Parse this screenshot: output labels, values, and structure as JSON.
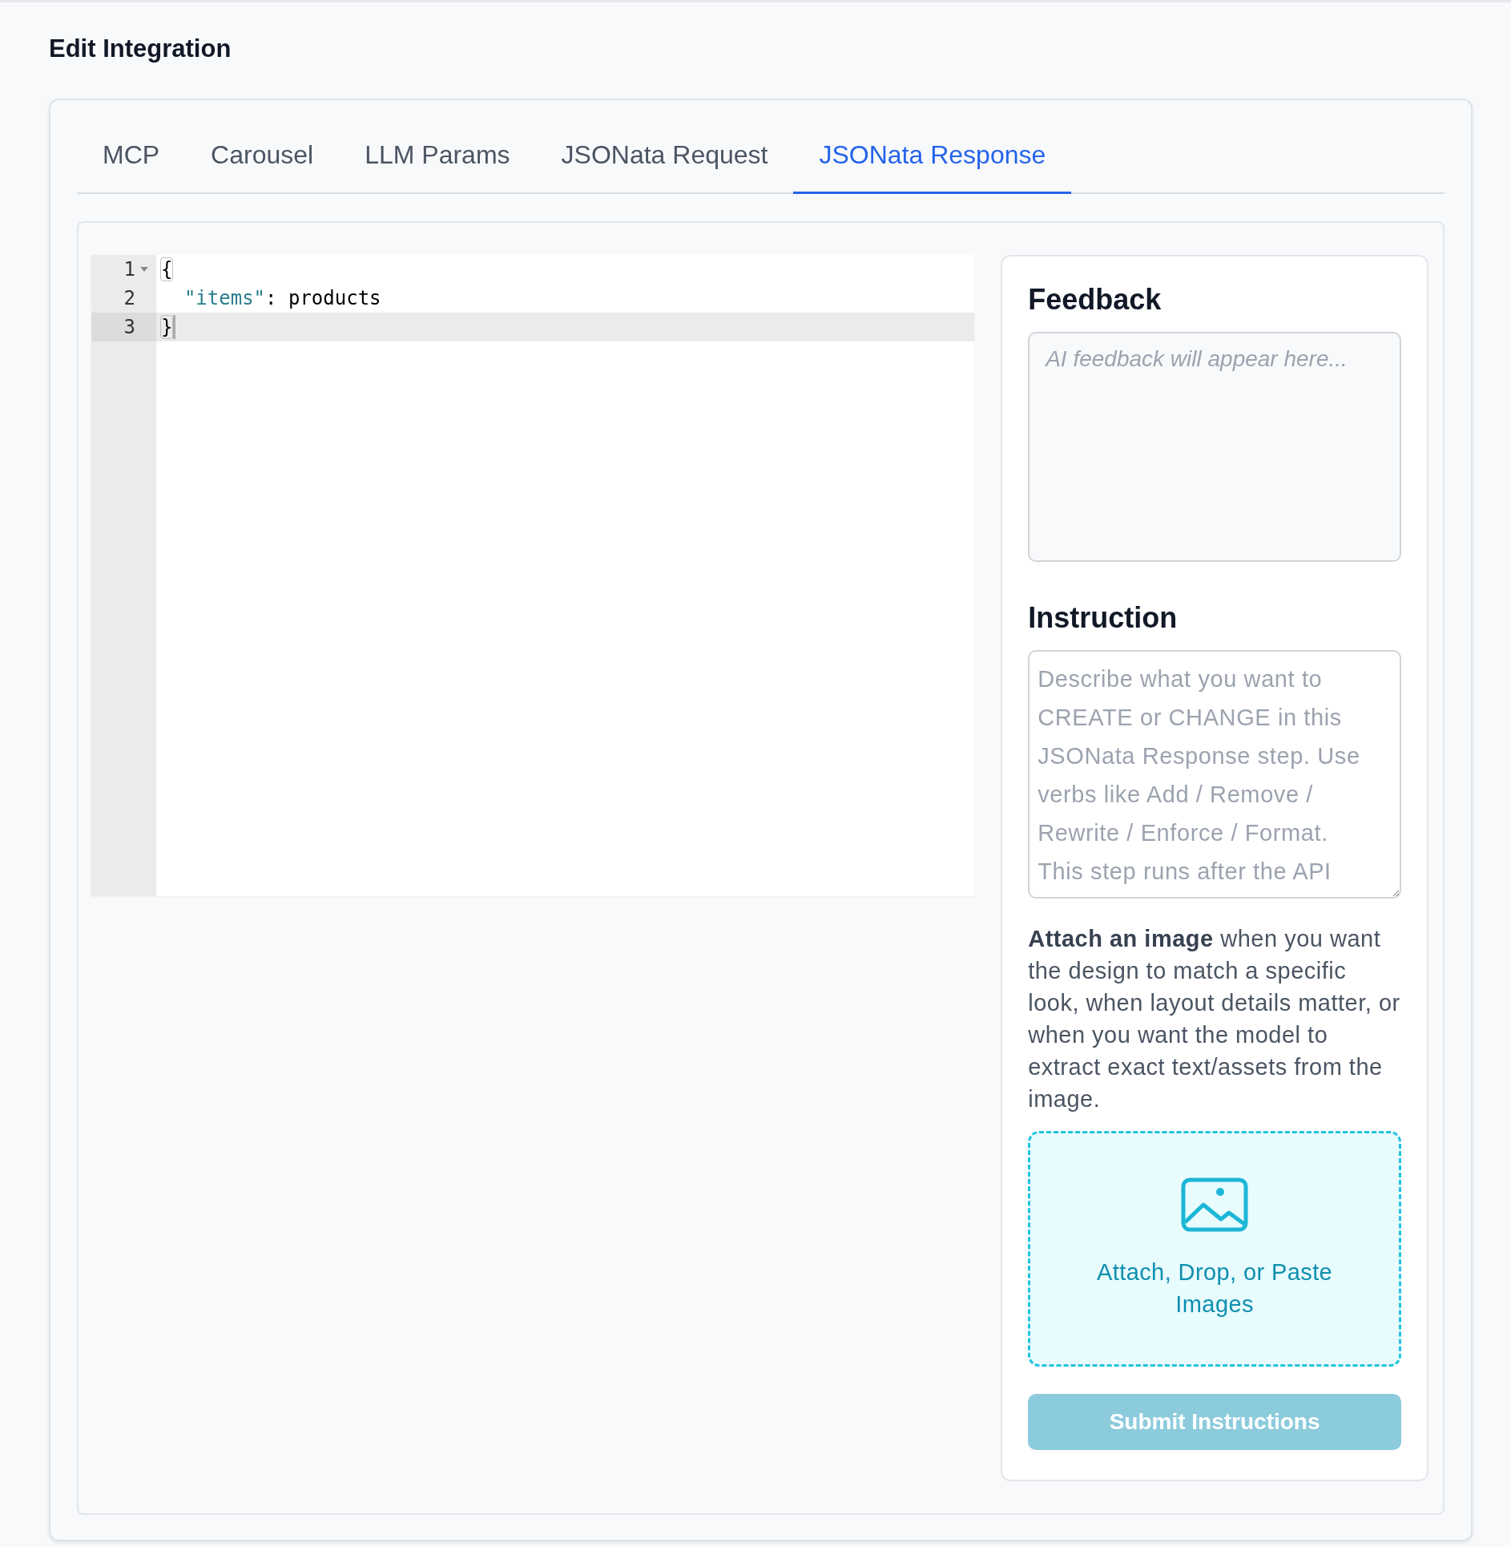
{
  "page_title": "Edit Integration",
  "tabs": [
    {
      "label": "MCP",
      "selected": false
    },
    {
      "label": "Carousel",
      "selected": false
    },
    {
      "label": "LLM Params",
      "selected": false
    },
    {
      "label": "JSONata Request",
      "selected": false
    },
    {
      "label": "JSONata Response",
      "selected": true
    }
  ],
  "editor": {
    "lines": [
      {
        "number": "1",
        "foldable": true,
        "active": false,
        "tokens": [
          {
            "kind": "bracket",
            "text": "{"
          }
        ]
      },
      {
        "number": "2",
        "foldable": false,
        "active": false,
        "tokens": [
          {
            "kind": "string",
            "text": "  \"items\""
          },
          {
            "kind": "plain",
            "text": ": products"
          }
        ]
      },
      {
        "number": "3",
        "foldable": false,
        "active": true,
        "tokens": [
          {
            "kind": "bracket",
            "text": "}"
          }
        ]
      }
    ]
  },
  "feedback": {
    "heading": "Feedback",
    "placeholder": "AI feedback will appear here..."
  },
  "instruction": {
    "heading": "Instruction",
    "placeholder": "Describe what you want to CREATE or CHANGE in this JSONata Response step. Use verbs like Add / Remove / Rewrite / Enforce / Format.\nThis step runs after the API"
  },
  "attach_note": "**Attach an image** when you want the design to match a specific look, when layout details matter, or when you want the model to extract exact text/assets from the image.",
  "dropzone": {
    "label": "Attach, Drop, or Paste Images"
  },
  "submit": {
    "label": "Submit Instructions",
    "disabled": true
  }
}
